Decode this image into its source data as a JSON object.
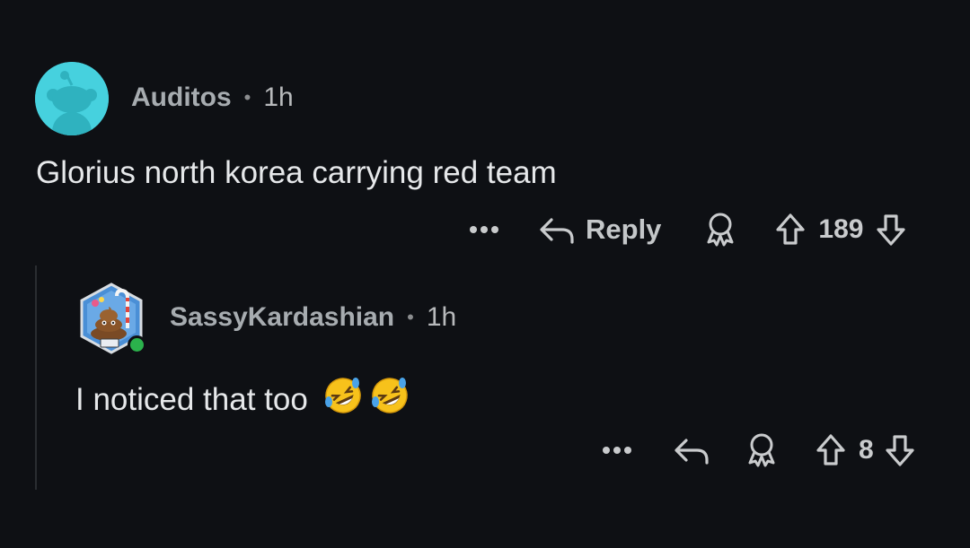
{
  "comments": [
    {
      "username": "Auditos",
      "separator": "•",
      "time": "1h",
      "text": "Glorius north korea carrying red team",
      "reply_label": "Reply",
      "score": "189",
      "avatar_color": "#46d1de"
    },
    {
      "username": "SassyKardashian",
      "separator": "•",
      "time": "1h",
      "text": "I noticed that too",
      "score": "8",
      "online_color": "#2bb24c"
    }
  ],
  "icons": {
    "more": "more-icon",
    "reply": "reply-icon",
    "award": "award-icon",
    "upvote": "upvote-icon",
    "downvote": "downvote-icon",
    "emoji": "rolling-on-floor-laughing-emoji"
  }
}
